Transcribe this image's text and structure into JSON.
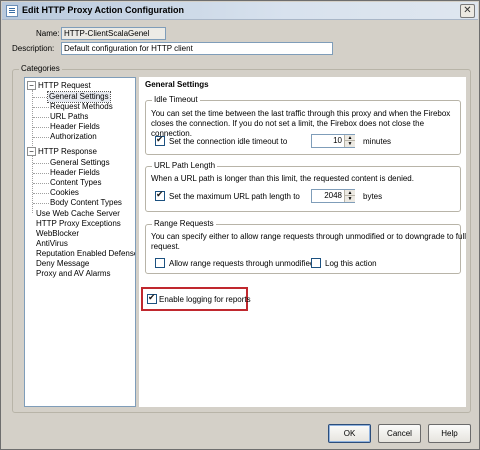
{
  "window": {
    "title": "Edit HTTP Proxy Action Configuration",
    "close_glyph": "✕"
  },
  "form": {
    "name_label": "Name:",
    "name_value": "HTTP-ClientScalaGenel",
    "description_label": "Description:",
    "description_value": "Default configuration for HTTP client"
  },
  "categories": {
    "legend": "Categories",
    "items": [
      {
        "label": "HTTP Request",
        "expander": "−"
      },
      {
        "label": "General Settings",
        "selected": true
      },
      {
        "label": "Request Methods"
      },
      {
        "label": "URL Paths"
      },
      {
        "label": "Header Fields"
      },
      {
        "label": "Authorization"
      },
      {
        "label": "HTTP Response",
        "expander": "−"
      },
      {
        "label": "General Settings"
      },
      {
        "label": "Header Fields"
      },
      {
        "label": "Content Types"
      },
      {
        "label": "Cookies"
      },
      {
        "label": "Body Content Types"
      },
      {
        "label": "Use Web Cache Server"
      },
      {
        "label": "HTTP Proxy Exceptions"
      },
      {
        "label": "WebBlocker"
      },
      {
        "label": "AntiVirus"
      },
      {
        "label": "Reputation Enabled Defense"
      },
      {
        "label": "Deny Message"
      },
      {
        "label": "Proxy and AV Alarms"
      }
    ]
  },
  "panel": {
    "title": "General Settings",
    "idle": {
      "legend": "Idle Timeout",
      "desc1": "You can set the time between the last traffic through this proxy and when the Firebox",
      "desc2": "closes the connection. If you do not set a limit, the Firebox does not close the connection.",
      "checkbox_label": "Set the connection idle timeout to",
      "checked": true,
      "value": "10",
      "unit": "minutes"
    },
    "url": {
      "legend": "URL Path Length",
      "desc": "When a URL path is longer than this limit, the requested content is denied.",
      "checkbox_label": "Set the maximum URL path length to",
      "checked": true,
      "value": "2048",
      "unit": "bytes"
    },
    "range": {
      "legend": "Range Requests",
      "desc1": "You can specify either to allow range requests through unmodified or to downgrade to full",
      "desc2": "request.",
      "allow_label": "Allow range requests through unmodified",
      "allow_checked": false,
      "log_label": "Log this action",
      "log_checked": false
    },
    "logging": {
      "label": "Enable logging for reports",
      "checked": true
    }
  },
  "buttons": {
    "ok": "OK",
    "cancel": "Cancel",
    "help": "Help"
  },
  "colors": {
    "highlight": "#c0282e",
    "window_bg": "#d4d0c8"
  }
}
